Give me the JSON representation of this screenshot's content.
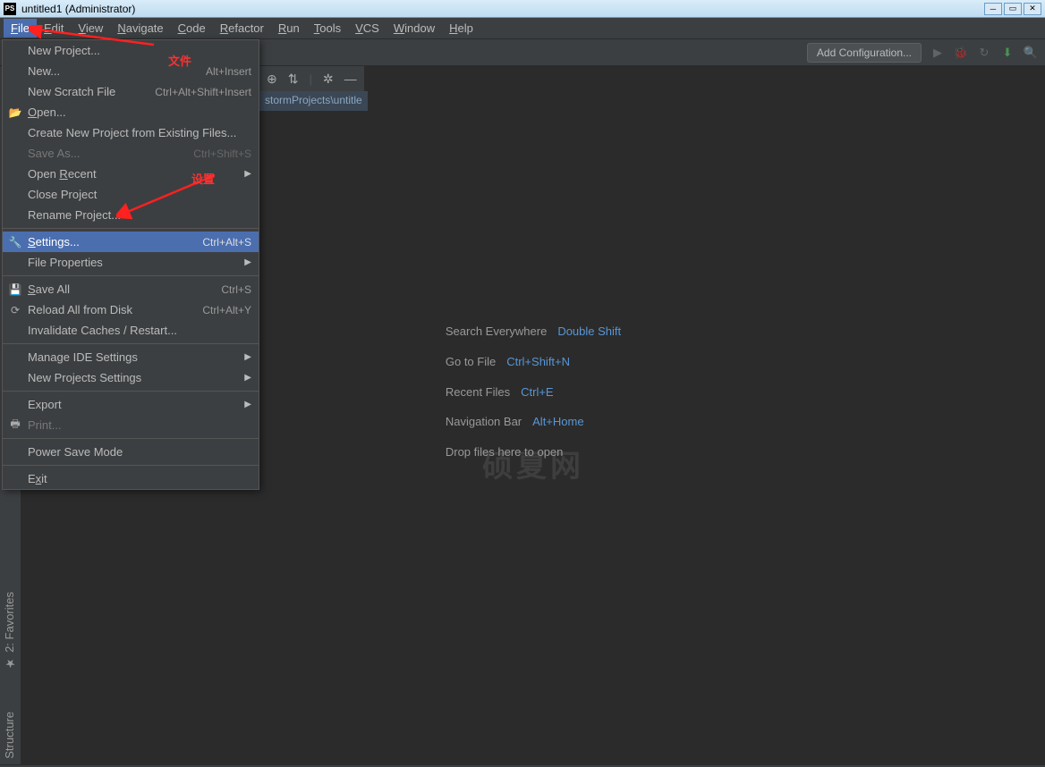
{
  "window": {
    "title": "untitled1 (Administrator)",
    "icon_label": "PS"
  },
  "menubar": [
    "File",
    "Edit",
    "View",
    "Navigate",
    "Code",
    "Refactor",
    "Run",
    "Tools",
    "VCS",
    "Window",
    "Help"
  ],
  "toolbar": {
    "add_config": "Add Configuration..."
  },
  "breadcrumb": "stormProjects\\untitle",
  "file_menu": [
    {
      "label": "New Project...",
      "type": "item"
    },
    {
      "label": "New...",
      "shortcut": "Alt+Insert",
      "type": "item"
    },
    {
      "label": "New Scratch File",
      "shortcut": "Ctrl+Alt+Shift+Insert",
      "type": "item"
    },
    {
      "label": "Open...",
      "icon": "folder",
      "ul": "O",
      "type": "item"
    },
    {
      "label": "Create New Project from Existing Files...",
      "type": "item"
    },
    {
      "label": "Save As...",
      "shortcut": "Ctrl+Shift+S",
      "disabled": true,
      "type": "item"
    },
    {
      "label": "Open Recent",
      "submenu": true,
      "ul": "R",
      "type": "item"
    },
    {
      "label": "Close Project",
      "type": "item"
    },
    {
      "label": "Rename Project...",
      "type": "item"
    },
    {
      "type": "sep"
    },
    {
      "label": "Settings...",
      "shortcut": "Ctrl+Alt+S",
      "icon": "wrench",
      "highlighted": true,
      "ul": "S",
      "type": "item"
    },
    {
      "label": "File Properties",
      "submenu": true,
      "type": "item"
    },
    {
      "type": "sep"
    },
    {
      "label": "Save All",
      "shortcut": "Ctrl+S",
      "icon": "save",
      "ul": "S",
      "type": "item"
    },
    {
      "label": "Reload All from Disk",
      "shortcut": "Ctrl+Alt+Y",
      "icon": "reload",
      "type": "item"
    },
    {
      "label": "Invalidate Caches / Restart...",
      "type": "item"
    },
    {
      "type": "sep"
    },
    {
      "label": "Manage IDE Settings",
      "submenu": true,
      "type": "item"
    },
    {
      "label": "New Projects Settings",
      "submenu": true,
      "type": "item"
    },
    {
      "type": "sep"
    },
    {
      "label": "Export",
      "submenu": true,
      "type": "item"
    },
    {
      "label": "Print...",
      "icon": "print",
      "disabled": true,
      "type": "item"
    },
    {
      "type": "sep"
    },
    {
      "label": "Power Save Mode",
      "type": "item"
    },
    {
      "type": "sep"
    },
    {
      "label": "Exit",
      "ul": "x",
      "type": "item"
    }
  ],
  "welcome": [
    {
      "label": "Search Everywhere",
      "key": "Double Shift"
    },
    {
      "label": "Go to File",
      "key": "Ctrl+Shift+N"
    },
    {
      "label": "Recent Files",
      "key": "Ctrl+E"
    },
    {
      "label": "Navigation Bar",
      "key": "Alt+Home"
    },
    {
      "label": "Drop files here to open",
      "key": ""
    }
  ],
  "watermark": "硕夏网",
  "annotations": {
    "file_label": "文件",
    "settings_label": "设置"
  },
  "gutter": {
    "favorites": "2: Favorites",
    "structure": "Structure"
  }
}
